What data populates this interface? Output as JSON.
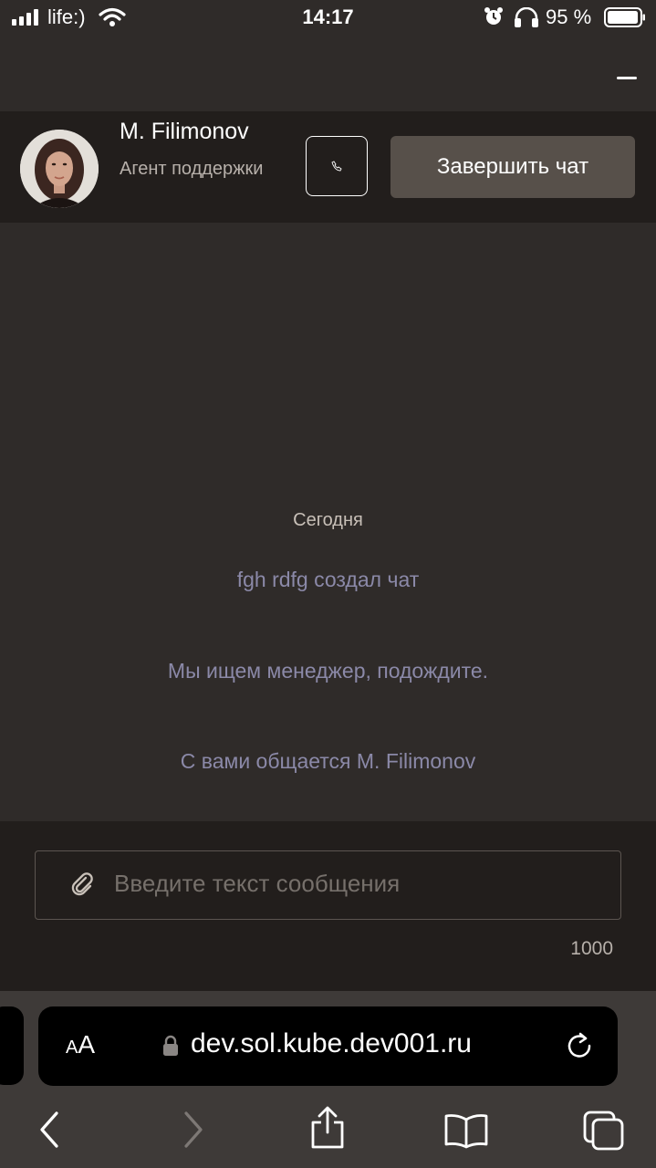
{
  "status_bar": {
    "carrier": "life:)",
    "time": "14:17",
    "battery": "95 %",
    "icons": [
      "signal-icon",
      "wifi-icon",
      "alarm-icon",
      "headphones-icon",
      "battery-icon"
    ]
  },
  "chat_header": {
    "minimize_icon": "minimize-icon",
    "agent": {
      "name": "M. Filimonov",
      "role": "Агент поддержки"
    },
    "call_icon": "phone-icon",
    "end_chat_label": "Завершить чат"
  },
  "messages": {
    "date_label": "Сегодня",
    "system": [
      "fgh rdfg создал чат",
      "Мы ищем менеджер, подождите.",
      "С вами общается M. Filimonov"
    ]
  },
  "composer": {
    "placeholder": "Введите текст сообщения",
    "attach_icon": "paperclip-icon",
    "char_limit": "1000"
  },
  "browser": {
    "aa_small": "A",
    "aa_big": "A",
    "url": "dev.sol.kube.dev001.ru",
    "toolbar_icons": [
      "back-icon",
      "forward-icon",
      "share-icon",
      "bookmarks-icon",
      "tabs-icon"
    ]
  },
  "colors": {
    "background": "#2f2b29",
    "header_bar": "#221e1c",
    "end_chat_button": "#57504a",
    "system_message": "#8b89a8",
    "date_label": "#c8c0b8"
  }
}
